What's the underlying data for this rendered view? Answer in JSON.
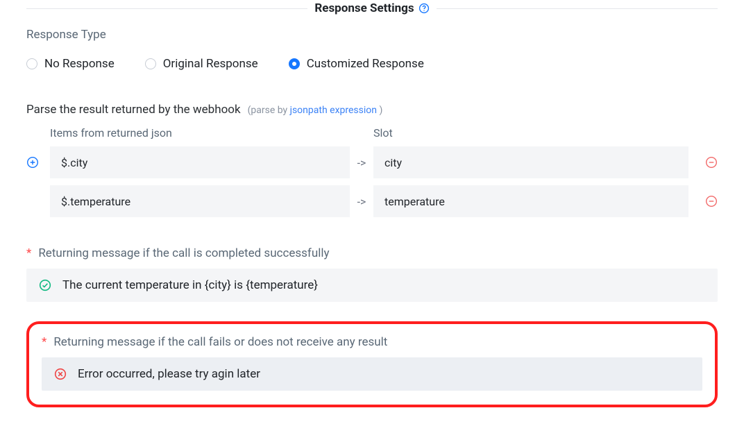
{
  "legend": {
    "title": "Response Settings"
  },
  "response_type": {
    "label": "Response Type",
    "selected": "customized",
    "options": {
      "no_response": "No Response",
      "original": "Original Response",
      "customized": "Customized Response"
    }
  },
  "parse": {
    "label": "Parse the result returned by the webhook",
    "sub_prefix": "(parse by ",
    "link": "jsonpath expression",
    "sub_suffix": " )",
    "columns": {
      "left": "Items from returned json",
      "right": "Slot"
    },
    "arrow": "->",
    "rows": [
      {
        "item": "$.city",
        "slot": "city"
      },
      {
        "item": "$.temperature",
        "slot": "temperature"
      }
    ]
  },
  "success": {
    "label": "Returning message if the call is completed successfully",
    "value": "The current temperature in {city} is {temperature}"
  },
  "failure": {
    "label": "Returning message if the call fails or does not receive any result",
    "value": "Error occurred, please try agin later"
  },
  "icons": {
    "help": "help-icon",
    "add": "add-icon",
    "remove": "remove-icon",
    "ok": "check-circle-icon",
    "err": "error-circle-icon"
  }
}
